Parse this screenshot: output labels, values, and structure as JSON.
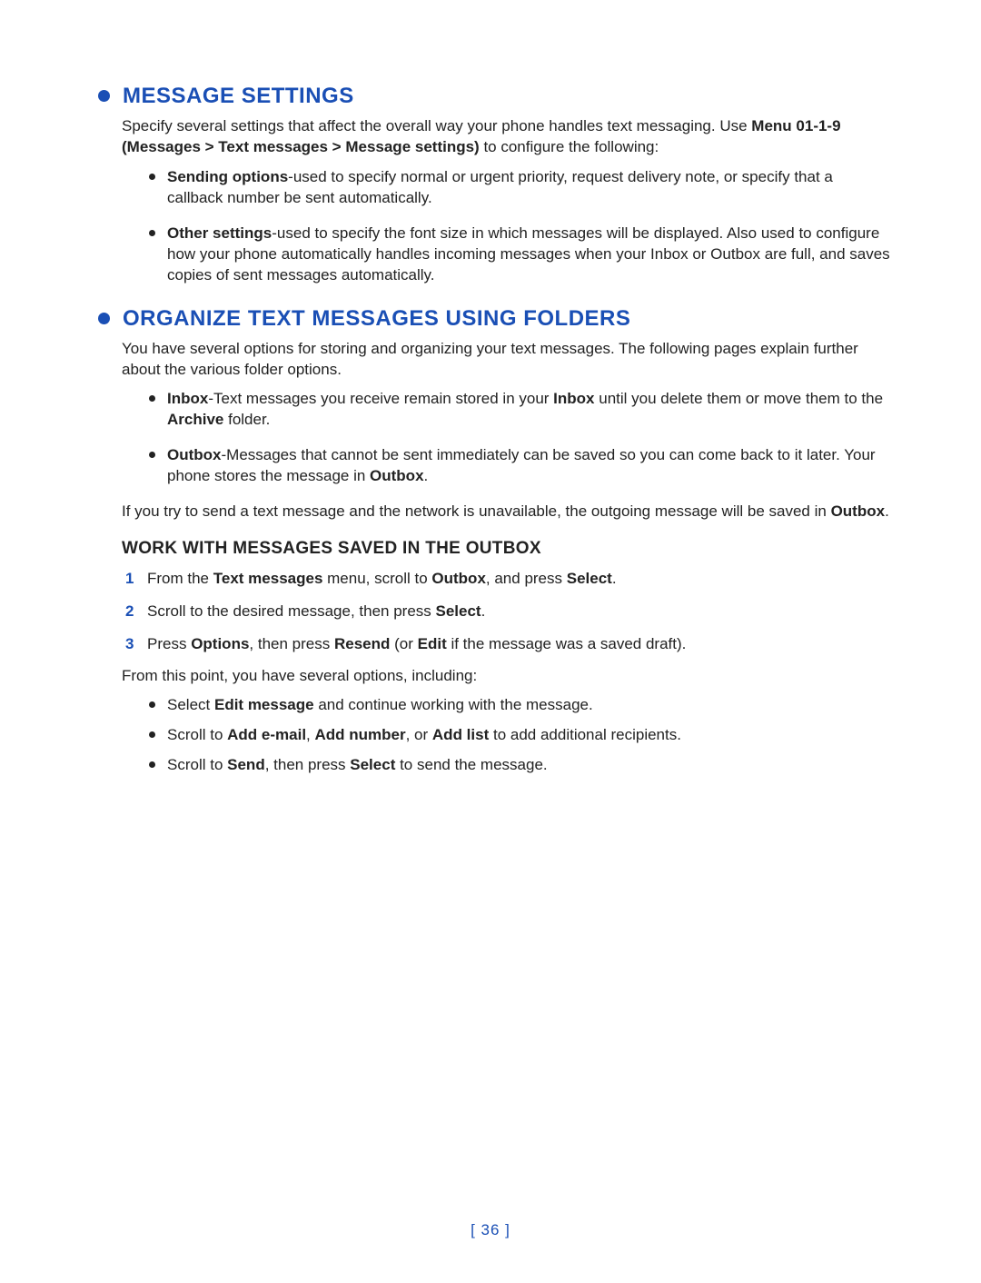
{
  "sections": {
    "messageSettings": {
      "title": "Message Settings",
      "intro_parts": [
        "Specify several settings that affect the overall way your phone handles text messaging. Use ",
        "Menu 01-1-9 (Messages > Text messages > Message settings)",
        " to configure the following:"
      ],
      "bullets": [
        {
          "lead": "Sending options",
          "rest": "-used to specify normal or urgent priority, request delivery note, or specify that a callback number be sent automatically."
        },
        {
          "lead": "Other settings",
          "rest": "-used to specify the font size in which messages will be displayed. Also used to configure how your phone automatically handles incoming messages when your Inbox or Outbox are full, and saves copies of sent messages automatically."
        }
      ]
    },
    "organize": {
      "title": "Organize Text Messages Using Folders",
      "intro": "You have several options for storing and organizing your text messages. The following pages explain further about the various folder options.",
      "bullets": [
        {
          "lead": "Inbox",
          "mid1": "-Text messages you receive remain stored in your ",
          "bold1": "Inbox",
          "mid2": " until you delete them or move them to the ",
          "bold2": "Archive",
          "tail": " folder."
        },
        {
          "lead": "Outbox",
          "mid1": "-Messages that cannot be sent immediately can be saved so you can come back to it later. Your phone stores the message in ",
          "bold1": "Outbox",
          "tail": "."
        }
      ],
      "after_parts": [
        "If you try to send a text message and the network is unavailable, the outgoing message will be saved in ",
        "Outbox",
        "."
      ],
      "subhead": "Work with messages saved in the Outbox",
      "steps": [
        {
          "parts": [
            "From the ",
            "Text messages",
            " menu, scroll to ",
            "Outbox",
            ", and press ",
            "Select",
            "."
          ]
        },
        {
          "parts": [
            "Scroll to the desired message, then press ",
            "Select",
            "."
          ]
        },
        {
          "parts": [
            "Press ",
            "Options",
            ", then press ",
            "Resend",
            " (or ",
            "Edit",
            " if the message was a saved draft)."
          ]
        }
      ],
      "after_steps": "From this point, you have several options, including:",
      "options": [
        {
          "parts": [
            "Select ",
            "Edit message",
            " and continue working with the message."
          ]
        },
        {
          "parts": [
            "Scroll to ",
            "Add e-mail",
            ", ",
            "Add number",
            ", or ",
            "Add list",
            " to add additional recipients."
          ]
        },
        {
          "parts": [
            "Scroll to ",
            "Send",
            ", then press ",
            "Select",
            " to send the message."
          ]
        }
      ]
    }
  },
  "page_number": "[ 36 ]"
}
